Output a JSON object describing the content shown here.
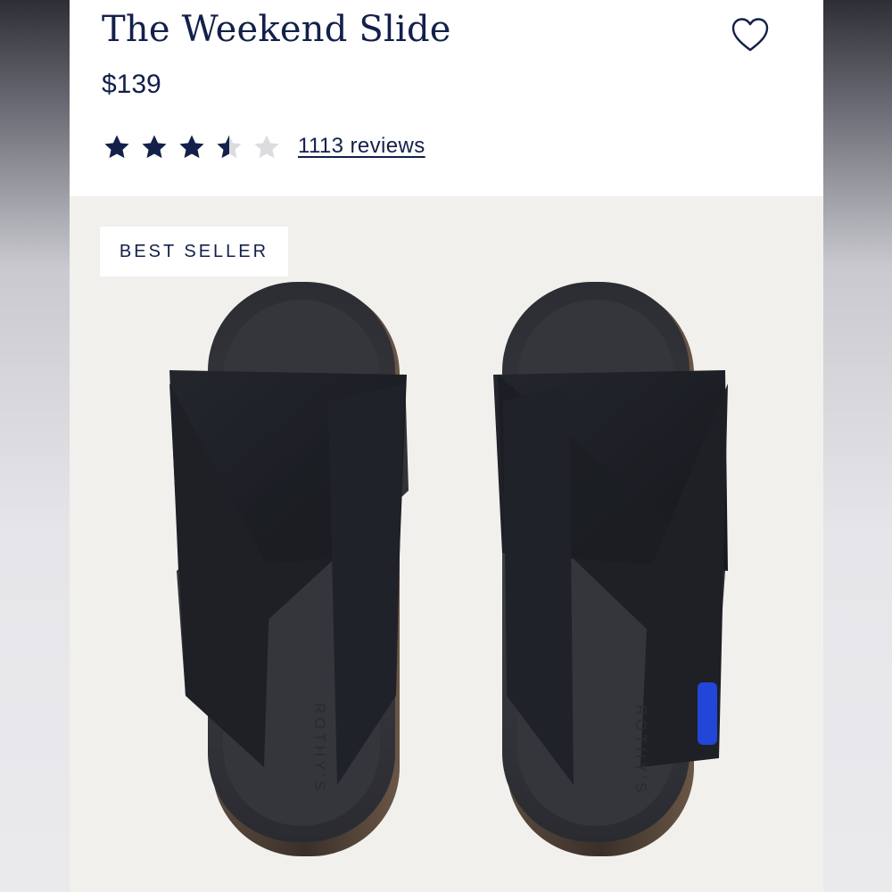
{
  "product": {
    "title": "The Weekend Slide",
    "price": "$139",
    "rating": 3.5,
    "rating_max": 5,
    "reviews_label": "1113 reviews",
    "badge": "BEST SELLER",
    "brand_mark": "ROTHY'S",
    "favorite_icon": "heart-outline-icon"
  },
  "colors": {
    "navy": "#13204a",
    "star_empty": "#dcdce0",
    "image_bg": "#f1f0ed",
    "accent_blue": "#2146d8"
  }
}
